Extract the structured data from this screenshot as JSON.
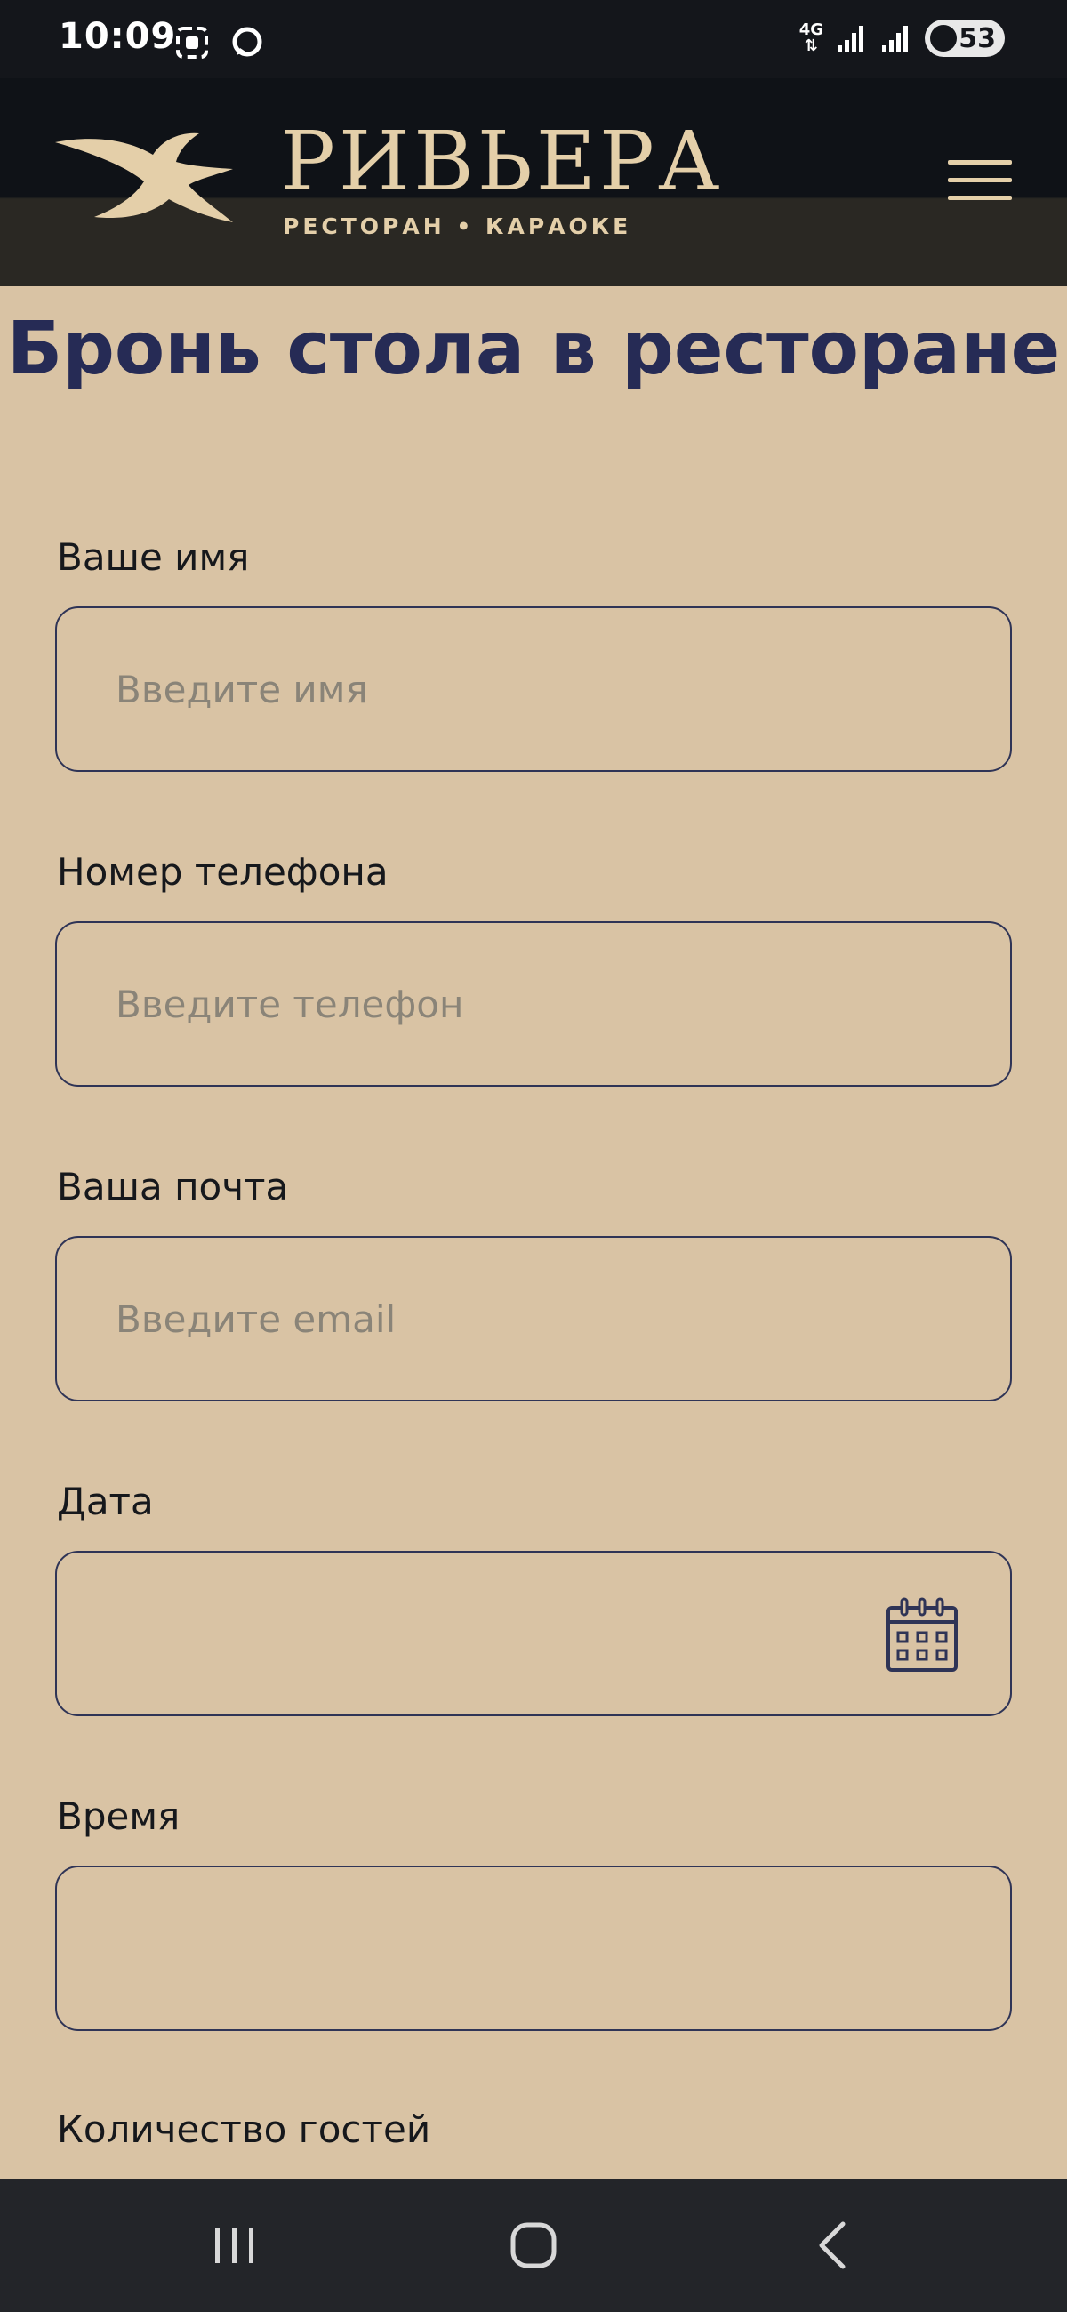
{
  "status_bar": {
    "time": "10:09",
    "network": "4G",
    "battery": "53"
  },
  "header": {
    "brand_name": "РИВЬЕРА",
    "brand_subtitle": "РЕСТОРАН • КАРАОКЕ",
    "menu_icon": "hamburger-menu-icon"
  },
  "page": {
    "title": "Бронь стола в ресторане"
  },
  "form": {
    "name": {
      "label": "Ваше имя",
      "placeholder": "Введите имя",
      "value": ""
    },
    "phone": {
      "label": "Номер телефона",
      "placeholder": "Введите телефон",
      "value": ""
    },
    "email": {
      "label": "Ваша почта",
      "placeholder": "Введите email",
      "value": ""
    },
    "date": {
      "label": "Дата",
      "value": "",
      "icon": "calendar-icon"
    },
    "time": {
      "label": "Время",
      "value": ""
    },
    "guests": {
      "label": "Количество гостей"
    }
  },
  "nav": {
    "recents_icon": "recent-apps-icon",
    "home_icon": "home-icon",
    "back_icon": "back-icon"
  },
  "colors": {
    "background": "#d9c3a4",
    "header": "#0f1217",
    "brand": "#e4cfa9",
    "title": "#262b55",
    "border": "#2f3456"
  }
}
